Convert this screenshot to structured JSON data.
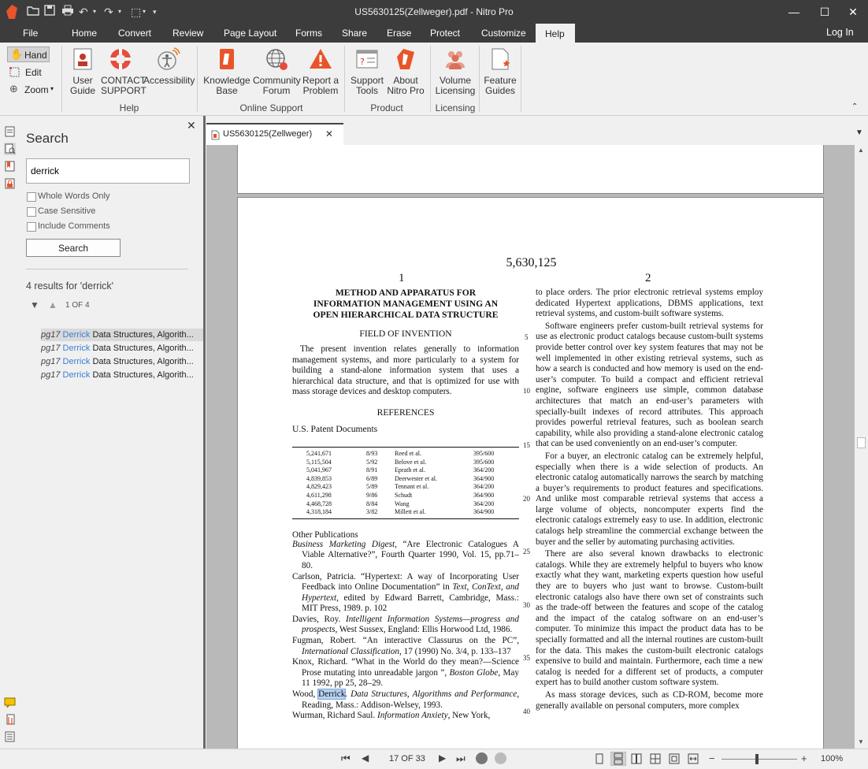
{
  "window": {
    "title": "US5630125(Zellweger).pdf - Nitro Pro"
  },
  "menu": {
    "file": "File",
    "tabs": [
      "Home",
      "Convert",
      "Review",
      "Page Layout",
      "Forms",
      "Share",
      "Erase",
      "Protect",
      "Customize",
      "Help"
    ],
    "active_tab": "Help",
    "login": "Log In"
  },
  "tools": {
    "hand": "Hand",
    "edit": "Edit",
    "zoom": "Zoom"
  },
  "ribbon": {
    "help_group": "Help",
    "online_group": "Online Support",
    "product_group": "Product",
    "licensing_group": "Licensing",
    "user_guide_1": "User",
    "user_guide_2": "Guide",
    "contact_1": "CONTACT",
    "contact_2": "SUPPORT",
    "accessibility": "Accessibility",
    "kb_1": "Knowledge",
    "kb_2": "Base",
    "forum_1": "Community",
    "forum_2": "Forum",
    "report_1": "Report a",
    "report_2": "Problem",
    "support_1": "Support",
    "support_2": "Tools",
    "about_1": "About",
    "about_2": "Nitro Pro",
    "volume_1": "Volume",
    "volume_2": "Licensing",
    "feature_1": "Feature",
    "feature_2": "Guides"
  },
  "search": {
    "title": "Search",
    "query": "derrick",
    "opt_whole": "Whole Words Only",
    "opt_case": "Case Sensitive",
    "opt_comments": "Include Comments",
    "button": "Search",
    "summary": "4 results for 'derrick'",
    "position": "1 OF 4",
    "results": [
      {
        "page": "pg17",
        "match": "Derrick",
        "rest": " Data Structures, Algorith..."
      },
      {
        "page": "pg17",
        "match": "Derrick",
        "rest": " Data Structures, Algorith..."
      },
      {
        "page": "pg17",
        "match": "Derrick",
        "rest": " Data Structures, Algorith..."
      },
      {
        "page": "pg17",
        "match": "Derrick",
        "rest": " Data Structures, Algorith..."
      }
    ]
  },
  "doc_tab": "US5630125(Zellweger)",
  "status": {
    "page_indicator": "17 OF 33",
    "zoom": "100%",
    "zoom_level": 1.0
  },
  "page": {
    "patent_no": "5,630,125",
    "col1": "1",
    "col2": "2",
    "title_1": "METHOD AND APPARATUS FOR",
    "title_2": "INFORMATION MANAGEMENT USING AN",
    "title_3": "OPEN HIERARCHICAL DATA STRUCTURE",
    "field_heading": "FIELD OF INVENTION",
    "field_text": "The present invention relates generally to information management systems, and more particularly to a system for building a stand-alone information system that uses a hierarchical data structure, and that is optimized for use with mass storage devices and desktop computers.",
    "references_heading": "REFERENCES",
    "patent_docs_heading": "U.S. Patent Documents",
    "patents": [
      [
        "5,241,671",
        "8/93",
        "Reed et al.",
        "395/600"
      ],
      [
        "5,115,504",
        "5/92",
        "Belove et al.",
        "395/600"
      ],
      [
        "5,041,967",
        "8/91",
        "Eprath et al.",
        "364/200"
      ],
      [
        "4,839,853",
        "6/89",
        "Deerwester et al.",
        "364/900"
      ],
      [
        "4,829,423",
        "5/89",
        "Tennant et al.",
        "364/200"
      ],
      [
        "4,611,298",
        "9/86",
        "Schudt",
        "364/900"
      ],
      [
        "4,468,728",
        "8/84",
        "Wang",
        "364/200"
      ],
      [
        "4,318,184",
        "3/82",
        "Millett et al.",
        "364/900"
      ]
    ],
    "other_pubs_heading": "Other Publications",
    "ref1_a": "Business Marketing Digest",
    "ref1_b": ", “Are Electronic Catalogues A Viable Alternative?”, Fourth Quarter 1990, Vol. 15, pp.71–80.",
    "ref2_a": "Carlson, Patricia. “Hypertext: A way of Incorporating User Feedback into Online Documentation” in ",
    "ref2_b": "Text, ConText, and Hypertext",
    "ref2_c": ", edited by Edward Barrett, Cambridge, Mass.: MIT Press, 1989. p. 102",
    "ref3_a": "Davies, Roy. ",
    "ref3_b": "Intelligent Information Systems—progress and prospects",
    "ref3_c": ", West Sussex, England: Ellis Horwood Ltd, 1986.",
    "ref4_a": "Fugman, Robert. “An interactive Classurus on the PC”, ",
    "ref4_b": "International Classification",
    "ref4_c": ", 17 (1990) No. 3/4, p. 133–137",
    "ref5_a": "Knox, Richard. “What in the World do they mean?—Science Prose mutating into unreadable jargon ”, ",
    "ref5_b": "Boston Globe",
    "ref5_c": ", May 11 1992, pp 25, 28–29.",
    "ref6_a": "Wood, ",
    "ref6_hl": "Derrick",
    "ref6_b": ". ",
    "ref6_c": "Data Structures, Algorithms and Performance",
    "ref6_d": ", Reading, Mass.: Addison-Welsey, 1993.",
    "ref7_a": "Wurman, Richard Saul. ",
    "ref7_b": "Information Anxiety",
    "ref7_c": ", New York,",
    "right_p1": "to place orders. The prior electronic retrieval systems employ dedicated Hypertext applications, DBMS applications, text retrieval systems, and custom-built software systems.",
    "right_p2": "Software engineers prefer custom-built retrieval systems for use as electronic product catalogs because custom-built systems provide better control over key system features that may not be well implemented in other existing retrieval systems, such as how a search is conducted and how memory is used on the end-user’s computer. To build a compact and efficient retrieval engine, software engineers use simple, common database architectures that match an end-user’s parameters with specially-built indexes of record attributes. This approach provides powerful retrieval features, such as boolean search capability, while also providing a stand-alone electronic catalog that can be used conveniently on an end-user’s computer.",
    "right_p3": "For a buyer, an electronic catalog can be extremely helpful, especially when there is a wide selection of products. An electronic catalog automatically narrows the search by matching a buyer’s requirements to product features and specifications. And unlike most comparable retrieval systems that access a large volume of objects, noncomputer experts find the electronic catalogs extremely easy to use. In addition, electronic catalogs help streamline the commercial exchange between the buyer and the seller by automating purchasing activities.",
    "right_p4": "There are also several known drawbacks to electronic catalogs. While they are extremely helpful to buyers who know exactly what they want, marketing experts question how useful they are to buyers who just want to browse. Custom-built electronic catalogs also have there own set of constraints such as the trade-off between the features and scope of the catalog and the impact of the catalog software on an end-user’s computer. To minimize this impact the product data has to be specially formatted and all the internal routines are custom-built for the data. This makes the custom-built electronic catalogs expensive to build and maintain. Furthermore, each time a new catalog is needed for a different set of products, a computer expert has to build another custom software system.",
    "right_p5": "As mass storage devices, such as CD-ROM, become more generally available on personal computers, more complex",
    "line_numbers": [
      "5",
      "10",
      "15",
      "20",
      "25",
      "30",
      "35",
      "40"
    ]
  }
}
